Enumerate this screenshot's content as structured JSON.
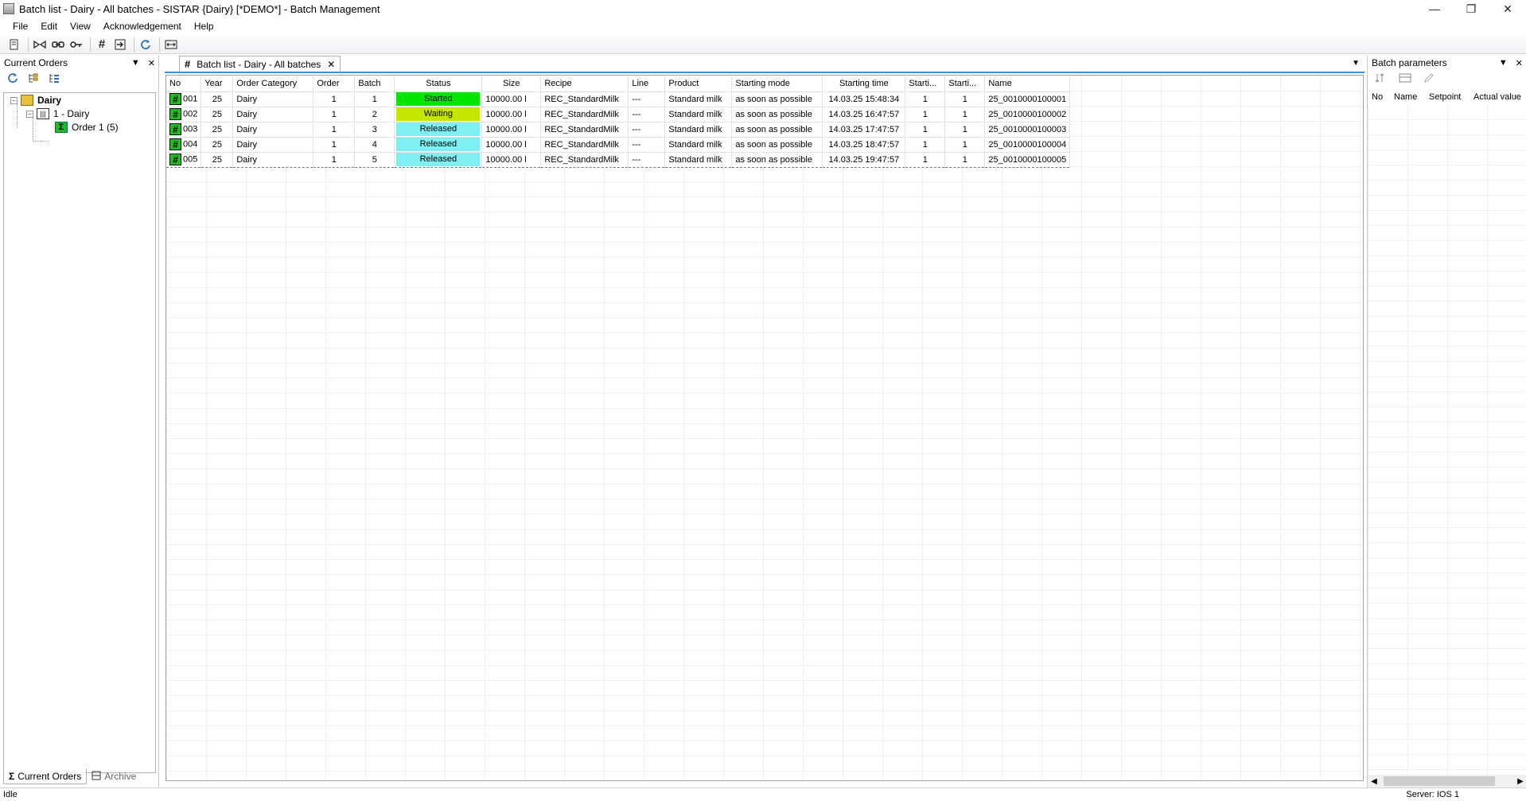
{
  "window": {
    "title": "Batch list - Dairy - All batches - SISTAR {Dairy} [*DEMO*] - Batch Management",
    "controls": {
      "minimize": "—",
      "restore": "❐",
      "close": "✕"
    }
  },
  "menu": [
    "File",
    "Edit",
    "View",
    "Acknowledgement",
    "Help"
  ],
  "left_panel": {
    "title": "Current Orders",
    "tree": {
      "root": "Dairy",
      "unit": "1 - Dairy",
      "order": "Order 1 (5)"
    },
    "tabs": [
      "Current Orders",
      "Archive"
    ]
  },
  "document": {
    "tab_label": "Batch list - Dairy - All batches",
    "columns": [
      "No",
      "Year",
      "Order Category",
      "Order",
      "Batch",
      "Status",
      "Size",
      "Recipe",
      "Line",
      "Product",
      "Starting mode",
      "Starting time",
      "Starti...",
      "Starti...",
      "Name"
    ],
    "rows": [
      {
        "no": "001",
        "year": "25",
        "category": "Dairy",
        "order": "1",
        "batch": "1",
        "status": "Started",
        "status_color": "#00e600",
        "size": "10000.00 l",
        "recipe": "REC_StandardMilk",
        "line": "---",
        "product": "Standard milk",
        "mode": "as soon as possible",
        "time": "14.03.25 15:48:34",
        "s1": "1",
        "s2": "1",
        "name": "25_0010000100001"
      },
      {
        "no": "002",
        "year": "25",
        "category": "Dairy",
        "order": "1",
        "batch": "2",
        "status": "Waiting",
        "status_color": "#c6e600",
        "size": "10000.00 l",
        "recipe": "REC_StandardMilk",
        "line": "---",
        "product": "Standard milk",
        "mode": "as soon as possible",
        "time": "14.03.25 16:47:57",
        "s1": "1",
        "s2": "1",
        "name": "25_0010000100002"
      },
      {
        "no": "003",
        "year": "25",
        "category": "Dairy",
        "order": "1",
        "batch": "3",
        "status": "Released",
        "status_color": "#7ef0f4",
        "size": "10000.00 l",
        "recipe": "REC_StandardMilk",
        "line": "---",
        "product": "Standard milk",
        "mode": "as soon as possible",
        "time": "14.03.25 17:47:57",
        "s1": "1",
        "s2": "1",
        "name": "25_0010000100003"
      },
      {
        "no": "004",
        "year": "25",
        "category": "Dairy",
        "order": "1",
        "batch": "4",
        "status": "Released",
        "status_color": "#7ef0f4",
        "size": "10000.00 l",
        "recipe": "REC_StandardMilk",
        "line": "---",
        "product": "Standard milk",
        "mode": "as soon as possible",
        "time": "14.03.25 18:47:57",
        "s1": "1",
        "s2": "1",
        "name": "25_0010000100004"
      },
      {
        "no": "005",
        "year": "25",
        "category": "Dairy",
        "order": "1",
        "batch": "5",
        "status": "Released",
        "status_color": "#7ef0f4",
        "size": "10000.00 l",
        "recipe": "REC_StandardMilk",
        "line": "---",
        "product": "Standard milk",
        "mode": "as soon as possible",
        "time": "14.03.25 19:47:57",
        "s1": "1",
        "s2": "1",
        "name": "25_0010000100005"
      }
    ]
  },
  "right_panel": {
    "title": "Batch parameters",
    "columns": [
      "No",
      "Name",
      "Setpoint",
      "Actual value"
    ]
  },
  "status_bar": {
    "left": "Idle",
    "right": "Server: IOS 1"
  },
  "colors": {
    "accent": "#3c8ddc",
    "hash_green": "#22bb22"
  }
}
